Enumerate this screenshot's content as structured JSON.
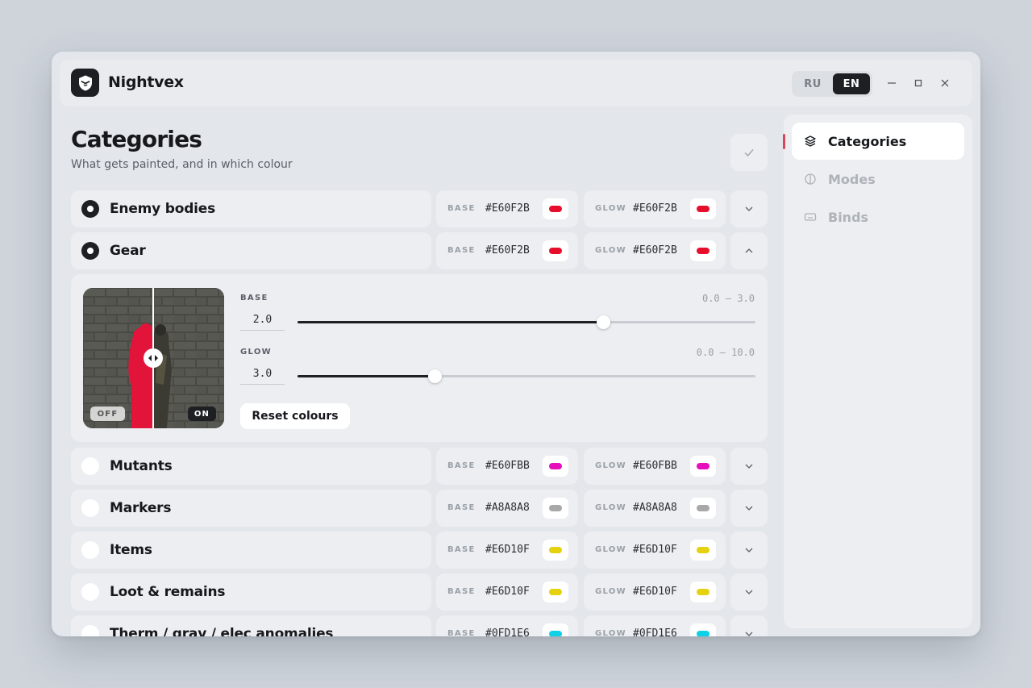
{
  "app": {
    "name": "Nightvex",
    "languages": [
      "RU",
      "EN"
    ],
    "active_language": "EN"
  },
  "header": {
    "title": "Categories",
    "subtitle": "What gets painted, and in which colour"
  },
  "categories": [
    {
      "label": "Enemy bodies",
      "selected": true,
      "base_tag": "BASE",
      "base_hex": "#E60F2B",
      "glow_tag": "GLOW",
      "glow_hex": "#E60F2B",
      "base_color": "#e60f2b",
      "glow_color": "#e60f2b",
      "expanded": false
    },
    {
      "label": "Gear",
      "selected": true,
      "base_tag": "BASE",
      "base_hex": "#E60F2B",
      "glow_tag": "GLOW",
      "glow_hex": "#E60F2B",
      "base_color": "#e60f2b",
      "glow_color": "#e60f2b",
      "expanded": true
    },
    {
      "label": "Mutants",
      "selected": false,
      "base_tag": "BASE",
      "base_hex": "#E60FBB",
      "glow_tag": "GLOW",
      "glow_hex": "#E60FBB",
      "base_color": "#e60fbb",
      "glow_color": "#e60fbb",
      "expanded": false
    },
    {
      "label": "Markers",
      "selected": false,
      "base_tag": "BASE",
      "base_hex": "#A8A8A8",
      "glow_tag": "GLOW",
      "glow_hex": "#A8A8A8",
      "base_color": "#a8a8a8",
      "glow_color": "#a8a8a8",
      "expanded": false
    },
    {
      "label": "Items",
      "selected": false,
      "base_tag": "BASE",
      "base_hex": "#E6D10F",
      "glow_tag": "GLOW",
      "glow_hex": "#E6D10F",
      "base_color": "#e6d10f",
      "glow_color": "#e6d10f",
      "expanded": false
    },
    {
      "label": "Loot & remains",
      "selected": false,
      "base_tag": "BASE",
      "base_hex": "#E6D10F",
      "glow_tag": "GLOW",
      "glow_hex": "#E6D10F",
      "base_color": "#e6d10f",
      "glow_color": "#e6d10f",
      "expanded": false
    },
    {
      "label": "Therm / grav / elec anomalies",
      "selected": false,
      "base_tag": "BASE",
      "base_hex": "#0FD1E6",
      "glow_tag": "GLOW",
      "glow_hex": "#0FD1E6",
      "base_color": "#0fd1e6",
      "glow_color": "#0fd1e6",
      "expanded": false
    }
  ],
  "expanded": {
    "preview": {
      "off_label": "OFF",
      "on_label": "ON"
    },
    "base": {
      "label": "BASE",
      "value": "2.0",
      "range": "0.0 – 3.0",
      "min": 0,
      "max": 3,
      "level": 2.0
    },
    "glow": {
      "label": "GLOW",
      "value": "3.0",
      "range": "0.0 – 10.0",
      "min": 0,
      "max": 10,
      "level": 3.0
    },
    "reset_label": "Reset colours"
  },
  "sidebar": {
    "items": [
      {
        "label": "Categories",
        "icon": "layers-icon",
        "active": true
      },
      {
        "label": "Modes",
        "icon": "circle-half-icon",
        "active": false
      },
      {
        "label": "Binds",
        "icon": "keyboard-icon",
        "active": false
      }
    ]
  },
  "colors": {
    "accent": "#d8465a",
    "dark": "#1d1f23"
  }
}
